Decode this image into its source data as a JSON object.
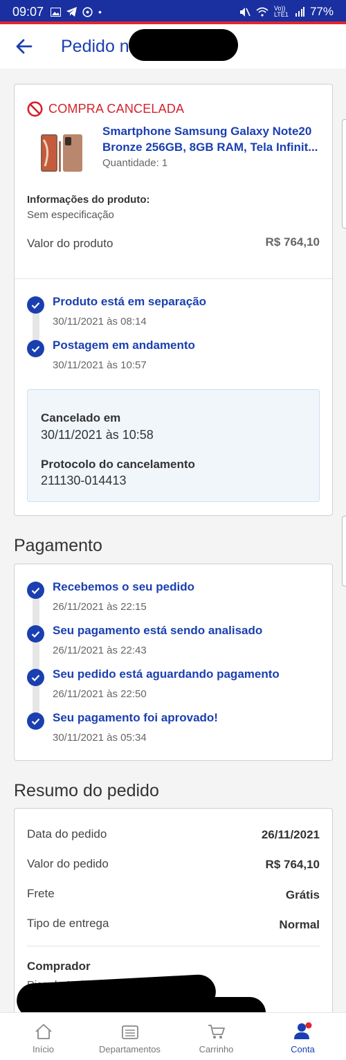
{
  "status_bar": {
    "time": "09:07",
    "network": "Vo)) LTE1",
    "battery": "77%"
  },
  "header": {
    "title": "Pedido nº"
  },
  "order": {
    "status": "COMPRA CANCELADA",
    "product_name": "Smartphone Samsung Galaxy Note20 Bronze 256GB, 8GB RAM, Tela Infinit...",
    "quantity": "Quantidade: 1",
    "info_label": "Informações do produto:",
    "info_value": "Sem especificação",
    "value_label": "Valor do produto",
    "value_amount": "R$ 764,10",
    "timeline": [
      {
        "title": "Produto está em separação",
        "date": "30/11/2021 às 08:14"
      },
      {
        "title": "Postagem em andamento",
        "date": "30/11/2021 às 10:57"
      }
    ],
    "cancel": {
      "cancelled_label": "Cancelado em",
      "cancelled_value": "30/11/2021 às 10:58",
      "protocol_label": "Protocolo do cancelamento",
      "protocol_value": "211130-014413"
    }
  },
  "payment": {
    "title": "Pagamento",
    "timeline": [
      {
        "title": "Recebemos o seu pedido",
        "date": "26/11/2021 às 22:15"
      },
      {
        "title": "Seu pagamento está sendo analisado",
        "date": "26/11/2021 às 22:43"
      },
      {
        "title": "Seu pedido está aguardando pagamento",
        "date": "26/11/2021 às 22:50"
      },
      {
        "title": "Seu pagamento foi aprovado!",
        "date": "30/11/2021 às 05:34"
      }
    ]
  },
  "summary": {
    "title": "Resumo do pedido",
    "rows": [
      {
        "label": "Data do pedido",
        "value": "26/11/2021"
      },
      {
        "label": "Valor do pedido",
        "value": "R$ 764,10"
      },
      {
        "label": "Frete",
        "value": "Grátis"
      },
      {
        "label": "Tipo de entrega",
        "value": "Normal"
      }
    ],
    "buyer_label": "Comprador",
    "buyer_name": "Ricardo Anderson C"
  },
  "bottom_nav": [
    {
      "label": "Início",
      "icon": "home-icon"
    },
    {
      "label": "Departamentos",
      "icon": "departments-icon"
    },
    {
      "label": "Carrinho",
      "icon": "cart-icon"
    },
    {
      "label": "Conta",
      "icon": "account-icon"
    }
  ],
  "colors": {
    "accent": "#1a3fb0",
    "status_bar": "#1a2fa0",
    "cancel_red": "#d3232e"
  }
}
